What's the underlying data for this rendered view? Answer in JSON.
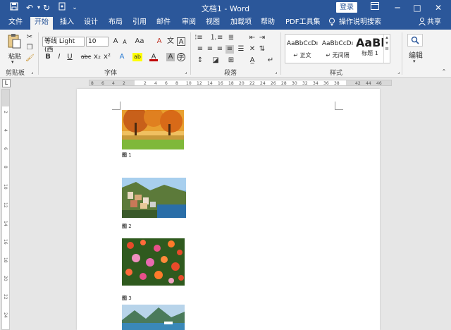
{
  "window": {
    "title": "文档1 - Word",
    "login_label": "登录",
    "minimize": "─",
    "restore": "□",
    "close": "✕",
    "ribbon_display_icon": "ribbon-display-icon"
  },
  "quick_access": {
    "save_icon": "save-icon",
    "undo_icon": "undo-icon",
    "redo_icon": "redo-icon",
    "touch_mode_icon": "touch-mode-icon",
    "customize_icon": "chevron-down-icon"
  },
  "tabs": [
    {
      "label": "文件",
      "active": false
    },
    {
      "label": "开始",
      "active": true
    },
    {
      "label": "插入",
      "active": false
    },
    {
      "label": "设计",
      "active": false
    },
    {
      "label": "布局",
      "active": false
    },
    {
      "label": "引用",
      "active": false
    },
    {
      "label": "邮件",
      "active": false
    },
    {
      "label": "审阅",
      "active": false
    },
    {
      "label": "视图",
      "active": false
    },
    {
      "label": "加载项",
      "active": false
    },
    {
      "label": "帮助",
      "active": false
    },
    {
      "label": "PDF工具集",
      "active": false
    }
  ],
  "tell_me": "操作说明搜索",
  "share": "共享",
  "ribbon": {
    "clipboard": {
      "paste_label": "粘贴",
      "group_label": "剪贴板"
    },
    "font": {
      "font_name": "等线 Light (西",
      "font_size": "10",
      "group_label": "字体",
      "bold": "B",
      "italic": "I",
      "underline": "U",
      "strike": "abc",
      "subscript": "x₂",
      "superscript": "x²",
      "grow": "A",
      "shrink": "A",
      "case": "Aa",
      "clear": "A",
      "phonetic": "文",
      "border_char": "A",
      "text_effect": "A",
      "highlight": "ab",
      "font_color": "A",
      "shading": "A",
      "enclose": "字"
    },
    "paragraph": {
      "group_label": "段落"
    },
    "styles": {
      "group_label": "样式",
      "items": [
        {
          "preview": "AaBbCcDı",
          "name": "↵ 正文"
        },
        {
          "preview": "AaBbCcDı",
          "name": "↵ 无间隔"
        },
        {
          "preview": "AaBl",
          "name": "标题 1"
        }
      ]
    },
    "editing": {
      "label": "编辑"
    }
  },
  "ruler": {
    "h_numbers": [
      "8",
      "6",
      "4",
      "2",
      "",
      "2",
      "4",
      "6",
      "8",
      "10",
      "12",
      "14",
      "16",
      "18",
      "20",
      "22",
      "24",
      "26",
      "28",
      "30",
      "32",
      "34",
      "36",
      "38",
      "",
      "42",
      "44",
      "46"
    ],
    "v_numbers": [
      "2",
      "4",
      "6",
      "8",
      "10",
      "12",
      "14",
      "16",
      "18",
      "20",
      "22",
      "24"
    ]
  },
  "document": {
    "figures": [
      {
        "label": "图",
        "number": "1",
        "scene": "autumn-forest"
      },
      {
        "label": "图",
        "number": "2",
        "scene": "coastal-village"
      },
      {
        "label": "图",
        "number": "3",
        "scene": "flowers"
      },
      {
        "label": "",
        "number": "",
        "scene": "mountain-lake"
      }
    ]
  },
  "colors": {
    "brand": "#2b579a",
    "ribbon_bg": "#f3f3f3",
    "workspace": "#e6e6e6"
  }
}
